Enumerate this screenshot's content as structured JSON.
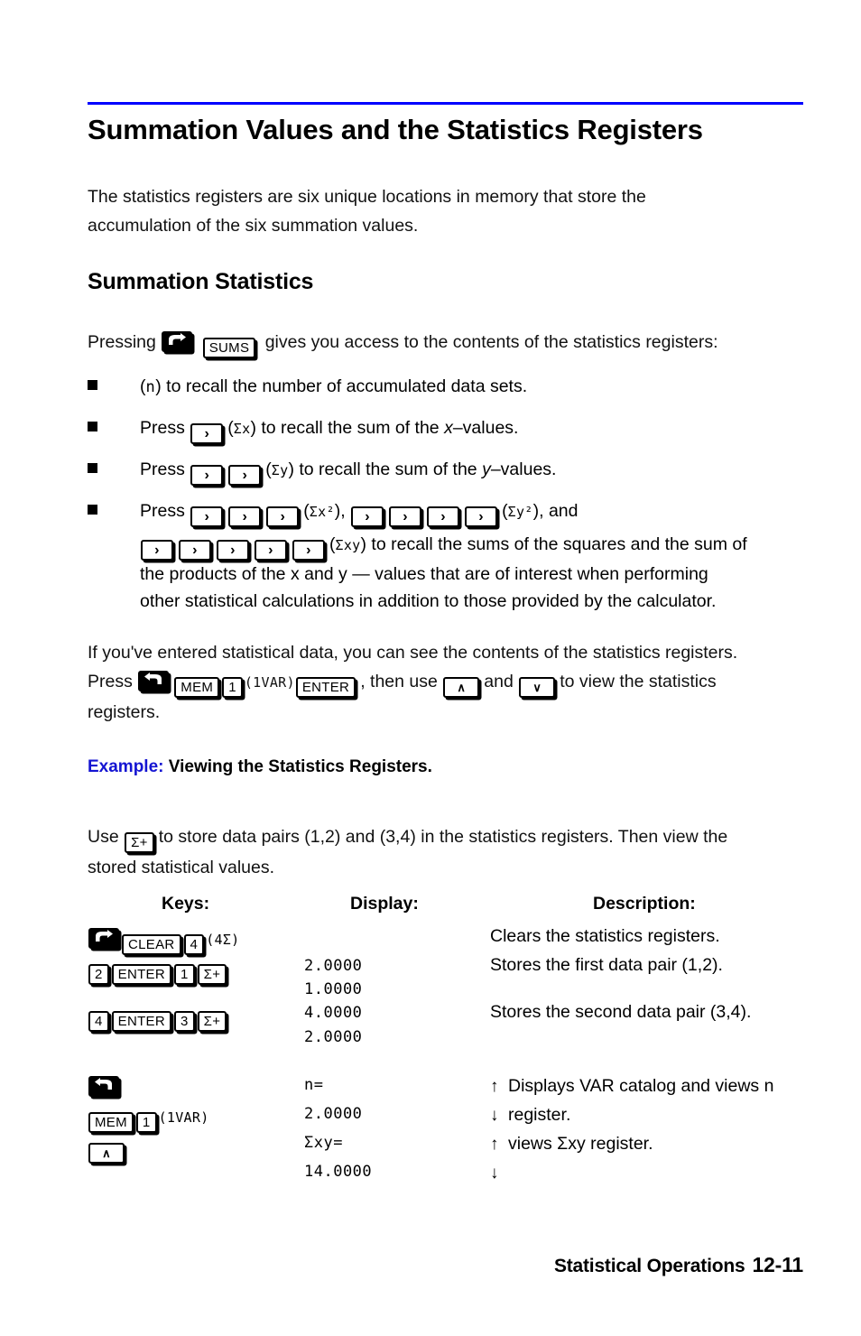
{
  "page": {
    "heading": "Summation Values and the Statistics Registers",
    "intro": "The statistics registers are six unique locations in memory that store the accumulation of the six summation values.",
    "section_heading": "Summation Statistics"
  },
  "press_line": {
    "prefix": "Pressing",
    "key_shift_right": "right-shift",
    "key_sums": "SUMS",
    "suffix": "gives you access to the contents of the statistics registers:"
  },
  "bullets": [
    {
      "open_paren": "(",
      "register": "n",
      "close_paren": ")",
      "text": "to recall the number of accumulated data sets."
    },
    {
      "press": "Press",
      "keys": [
        ">"
      ],
      "open_paren": "(",
      "register": "Σx",
      "close_paren": ")",
      "text_before_var": "to recall the sum of the",
      "variable": "x",
      "text_after_var": "–values."
    },
    {
      "press": "Press",
      "keys": [
        ">",
        ">"
      ],
      "open_paren": "(",
      "register": "Σy",
      "close_paren": ")",
      "text_before_var": "to recall the sum of the",
      "variable": "y",
      "text_after_var": "–values."
    },
    {
      "press": "Press",
      "keys_a": [
        ">",
        ">",
        ">"
      ],
      "register_a": "Σx²",
      "keys_b": [
        ">",
        ">",
        ">",
        ">"
      ],
      "register_b": "Σy²",
      "and_word": ", and",
      "keys_c": [
        ">",
        ">",
        ">",
        ">",
        ">"
      ],
      "register_c": "Σxy",
      "line2_tail": "to recall the sums of the squares and the sum of",
      "line3": "the products of the x and y — values that are of interest when performing",
      "line4": "other statistical calculations in addition to those provided by the calculator."
    }
  ],
  "para_entered": {
    "line1": "If you've entered statistical data, you can see the contents of the statistics registers.",
    "press": "Press",
    "key_shift_left": "left-shift",
    "key_mem": "MEM",
    "key_1": "1",
    "annot_1var": "(1VAR)",
    "key_enter": "ENTER",
    "mid1": ", then use",
    "key_up": "∧",
    "and_word": "and",
    "key_down": "∨",
    "mid2": "to view the statistics",
    "line3": "registers."
  },
  "example": {
    "label": "Example:",
    "title": "Viewing the Statistics Registers."
  },
  "para_use": {
    "use": "Use",
    "key_sigma_plus": "Σ+",
    "tail": "to store data pairs (1,2) and (3,4) in the statistics registers. Then view the",
    "line2": "stored statistical values."
  },
  "table": {
    "headers": {
      "keys": "Keys:",
      "display": "Display:",
      "description": "Description:"
    },
    "key_rows": [
      {
        "keys": [
          "right-shift",
          "CLEAR",
          "4"
        ],
        "annotation": "(4Σ)"
      },
      {
        "keys": [
          "2",
          "ENTER",
          "1",
          "Σ+"
        ],
        "annotation": ""
      },
      {
        "keys": [
          "4",
          "ENTER",
          "3",
          "Σ+"
        ],
        "annotation": ""
      },
      {
        "keys": [
          "left-shift"
        ],
        "annotation": ""
      },
      {
        "keys": [
          "MEM",
          "1"
        ],
        "annotation": "(1VAR)"
      },
      {
        "keys": [
          "∧"
        ],
        "annotation": ""
      }
    ],
    "display_rows": [
      "2.0000",
      "1.0000",
      "4.0000",
      "2.0000",
      "n=",
      "2.0000",
      "Σxy=",
      "14.0000"
    ],
    "descriptions": [
      {
        "arrow": "",
        "text": "Clears the statistics registers."
      },
      {
        "arrow": "",
        "text": "Stores the first data pair (1,2)."
      },
      {
        "arrow": "",
        "text": "Stores the second data pair (3,4)."
      },
      {
        "arrow": "↑",
        "text": "Displays VAR catalog and views n"
      },
      {
        "arrow": "↓",
        "text": "register."
      },
      {
        "arrow": "↑",
        "text": "views Σxy register."
      },
      {
        "arrow": "↓",
        "text": ""
      }
    ]
  },
  "footer": {
    "chapter": "Statistical Operations",
    "page_number": "12-11"
  },
  "colors": {
    "rule": "#0000ff",
    "example_label": "#1414d2",
    "text": "#000000"
  }
}
